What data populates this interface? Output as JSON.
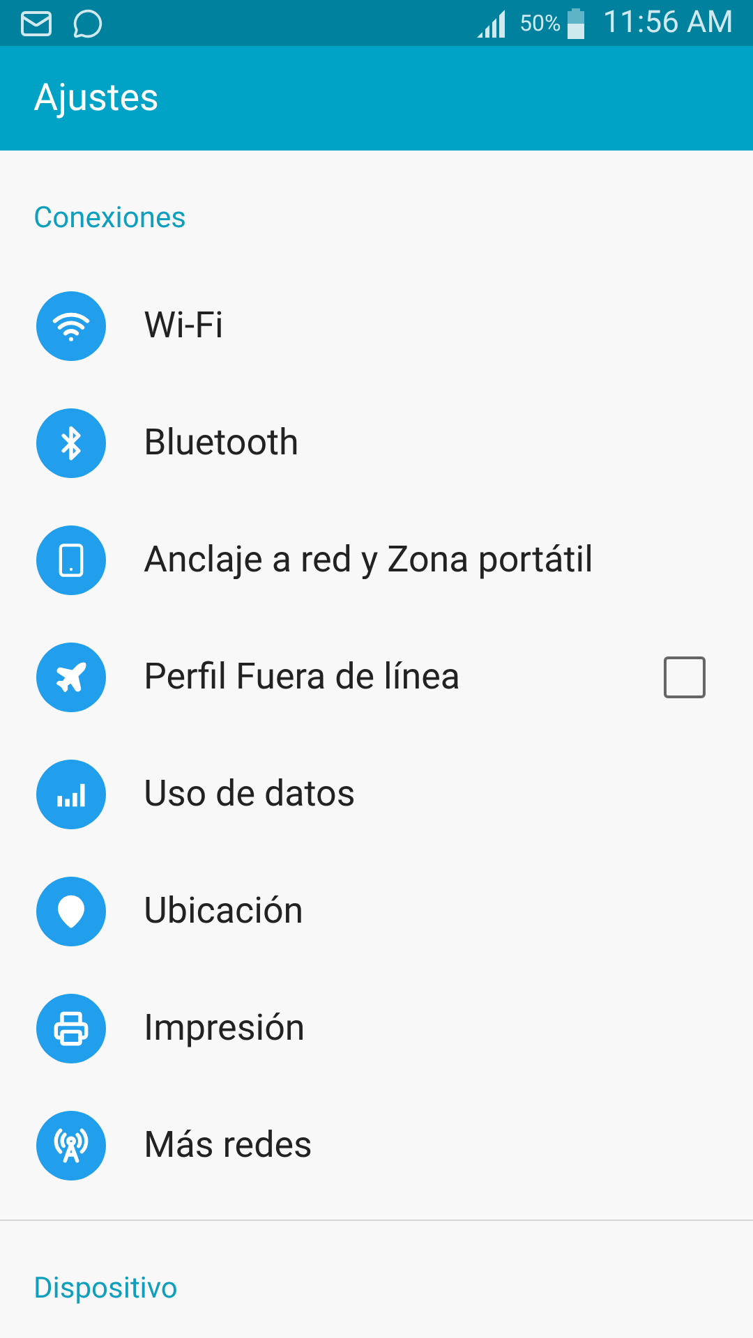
{
  "status_bar": {
    "battery": "50%",
    "time": "11:56 AM"
  },
  "app_bar": {
    "title": "Ajustes"
  },
  "sections": [
    {
      "title": "Conexiones",
      "items": [
        {
          "kind": "link",
          "label": "Wi-Fi"
        },
        {
          "kind": "link",
          "label": "Bluetooth"
        },
        {
          "kind": "link",
          "label": "Anclaje a red y Zona portátil"
        },
        {
          "kind": "checkbox",
          "label": "Perfil Fuera de línea",
          "checked": false
        },
        {
          "kind": "link",
          "label": "Uso de datos"
        },
        {
          "kind": "link",
          "label": "Ubicación"
        },
        {
          "kind": "link",
          "label": "Impresión"
        },
        {
          "kind": "link",
          "label": "Más redes"
        }
      ]
    },
    {
      "title": "Dispositivo"
    }
  ]
}
